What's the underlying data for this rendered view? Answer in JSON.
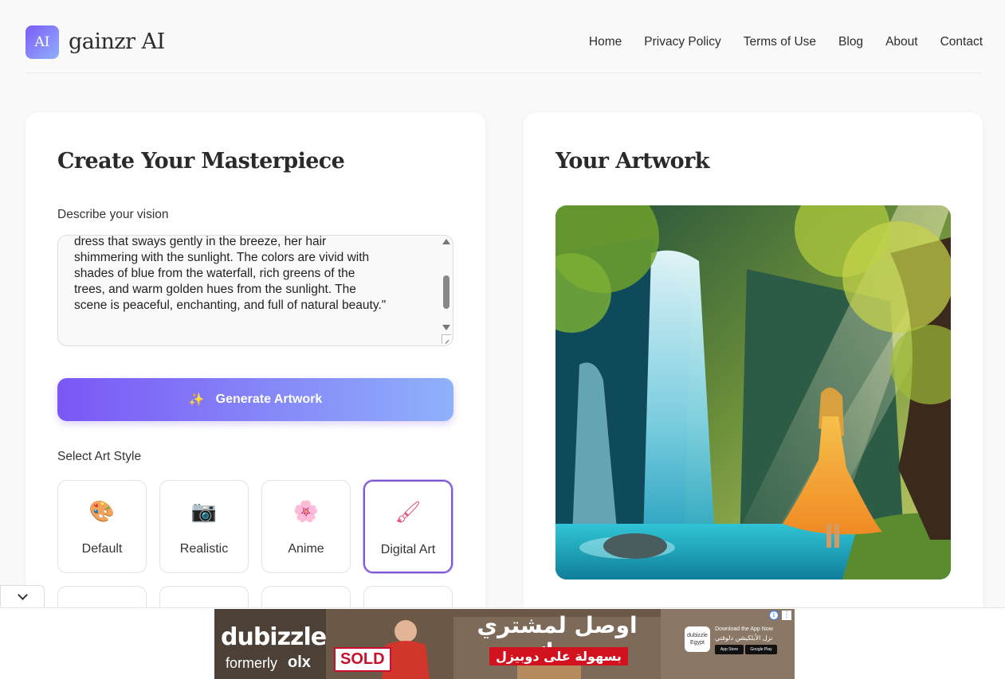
{
  "header": {
    "logo_badge": "AI",
    "brand": "gainzr AI",
    "nav": [
      "Home",
      "Privacy Policy",
      "Terms of Use",
      "Blog",
      "About",
      "Contact"
    ]
  },
  "create": {
    "title": "Create Your Masterpiece",
    "prompt_label": "Describe your vision",
    "prompt_value": "dress that sways gently in the breeze, her hair\nshimmering with the sunlight. The colors are vivid with\nshades of blue from the waterfall, rich greens of the\ntrees, and warm golden hues from the sunlight. The\nscene is peaceful, enchanting, and full of natural beauty.\"",
    "generate_label": "Generate Artwork",
    "generate_icon": "sparkles-icon",
    "style_label": "Select Art Style",
    "styles": [
      {
        "label": "Default",
        "icon": "🎨"
      },
      {
        "label": "Realistic",
        "icon": "📷"
      },
      {
        "label": "Anime",
        "icon": "🌸"
      },
      {
        "label": "Digital Art",
        "icon": "🖌"
      }
    ],
    "selected_style": "Digital Art"
  },
  "artwork": {
    "title": "Your Artwork"
  },
  "ad": {
    "brand": "dubizzle",
    "formerly": "formerly",
    "olx": "olx",
    "sold": "SOLD",
    "headline": "اوصل لمشتري بيتك",
    "subline": "بسهولة على دوبيزل",
    "store_text": "Download the App Now",
    "store_text_ar": "نزل الأبلكيشن دلوقتي",
    "app_store": "App Store",
    "google_play": "Google Play",
    "app_badge_line1": "dubizzle",
    "app_badge_line2": "Egypt"
  },
  "colors": {
    "accent_start": "#7b57f5",
    "accent_end": "#8fb1fb",
    "selected_border": "#7e57d9"
  }
}
